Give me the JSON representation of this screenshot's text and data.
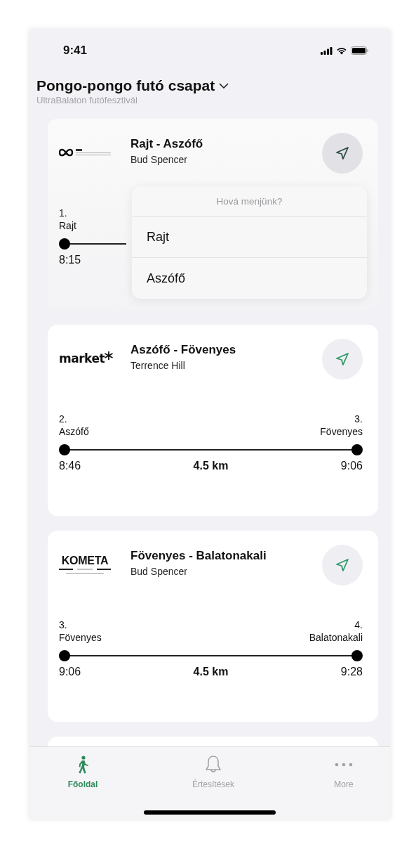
{
  "status_bar": {
    "time": "9:41"
  },
  "header": {
    "title": "Pongo-pongo futó csapat",
    "subtitle": "UltraBalaton futófesztivál"
  },
  "routes": [
    {
      "logo": {
        "kind": "infinity"
      },
      "title": "Rajt - Aszófő",
      "runner": "Bud Spencer",
      "dimmed": true,
      "from": {
        "number": "1.",
        "name": "Rajt",
        "time": "8:15"
      },
      "menu": {
        "title": "Hová menjünk?",
        "options": [
          "Rajt",
          "Aszófő"
        ]
      }
    },
    {
      "logo": {
        "kind": "market",
        "text": "market"
      },
      "title": "Aszófő - Fövenyes",
      "runner": "Terrence Hill",
      "dimmed": false,
      "from": {
        "number": "2.",
        "name": "Aszófő",
        "time": "8:46"
      },
      "to": {
        "number": "3.",
        "name": "Fövenyes",
        "time": "9:06"
      },
      "distance": "4.5 km"
    },
    {
      "logo": {
        "kind": "kometa",
        "text": "KOMETA"
      },
      "title": "Fövenyes - Balatonakali",
      "runner": "Bud Spencer",
      "dimmed": false,
      "from": {
        "number": "3.",
        "name": "Fövenyes",
        "time": "9:06"
      },
      "to": {
        "number": "4.",
        "name": "Balatonakali",
        "time": "9:28"
      },
      "distance": "4.5 km"
    }
  ],
  "tab_bar": [
    {
      "kind": "walk",
      "label": "Főoldal",
      "selected": true
    },
    {
      "kind": "bell",
      "label": "Értesítések",
      "selected": false
    },
    {
      "kind": "more",
      "label": "More",
      "selected": false
    }
  ]
}
